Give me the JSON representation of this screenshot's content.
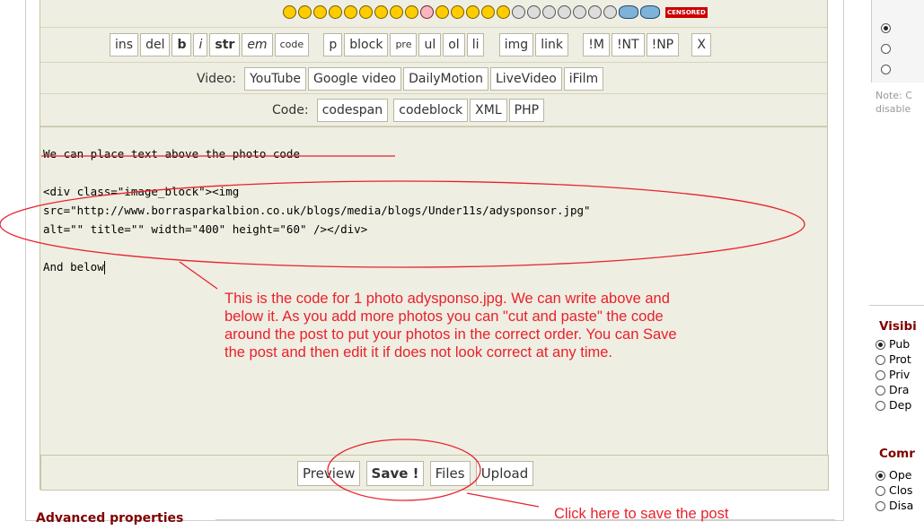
{
  "toolbar": {
    "tags": [
      "ins",
      "del",
      "b",
      "i",
      "str",
      "em",
      "code",
      "p",
      "block",
      "pre",
      "ul",
      "ol",
      "li",
      "img",
      "link",
      "!M",
      "!NT",
      "!NP",
      "X"
    ],
    "video_label": "Video:",
    "video_buttons": [
      "YouTube",
      "Google video",
      "DailyMotion",
      "LiveVideo",
      "iFilm"
    ],
    "code_label": "Code:",
    "code_buttons": [
      "codespan",
      "codeblock",
      "XML",
      "PHP"
    ],
    "censored_label": "CENSORED"
  },
  "editor": {
    "line1": "We can place text above the photo code",
    "line2": "<div class=\"image_block\"><img",
    "line3": "src=\"http://www.borrasparkalbion.co.uk/blogs/media/blogs/Under11s/adysponsor.jpg\"",
    "line4": "alt=\"\" title=\"\" width=\"400\" height=\"60\" /></div>",
    "line5": "And below"
  },
  "annotations": {
    "note_lines": [
      "This is the  code for 1 photo adysponso.jpg. We can write above and",
      "below it. As you add more photos you can \"cut and paste\" the code",
      "around the post to put your photos in the correct order. You can Save",
      "the post and then edit it if does not look correct at any time."
    ],
    "save_hint": "Click here to save the post",
    "color": "#e8212c"
  },
  "actions": {
    "preview": "Preview",
    "save": "Save !",
    "files": "Files",
    "upload": "Upload"
  },
  "advanced": {
    "title": "Advanced properties"
  },
  "sidebar": {
    "note": "Note: C",
    "note2": "disable",
    "visibility_title": "Visibi",
    "visibility_items": [
      "Pub",
      "Prot",
      "Priv",
      "Dra",
      "Dep"
    ],
    "comments_title": "Comr",
    "comments_items": [
      "Ope",
      "Clos",
      "Disa"
    ]
  }
}
